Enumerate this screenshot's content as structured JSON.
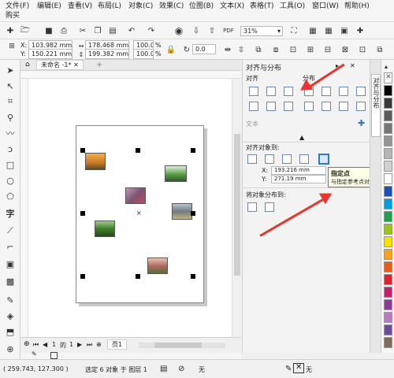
{
  "menu": [
    "文件(F)",
    "编辑(E)",
    "查看(V)",
    "布局(L)",
    "对象(C)",
    "效果(C)",
    "位图(B)",
    "文本(X)",
    "表格(T)",
    "工具(O)",
    "窗口(W)",
    "帮助(H)",
    "购买"
  ],
  "toolbar": {
    "zoom_value": "31%",
    "icons": [
      "new-icon",
      "open-icon",
      "save-icon",
      "print-icon",
      "cut-icon",
      "copy-icon",
      "paste-icon",
      "undo-icon",
      "redo-icon",
      "search-icon",
      "import-icon",
      "export-icon",
      "pdf-icon"
    ]
  },
  "properties": {
    "x_label": "X:",
    "x_value": "103.982 mm",
    "y_label": "Y:",
    "y_value": "150.221 mm",
    "w_value": "178.468 mm",
    "h_value": "199.382 mm",
    "scale_w": "100.0",
    "scale_h": "100.0",
    "pct": "%",
    "rotation": "0.0"
  },
  "document_tab": "未命名 -1*",
  "docker": {
    "title": "对齐与分布",
    "align_label": "对齐",
    "distribute_label": "分布",
    "text_label": "文本",
    "align_to_label": "对齐对象到:",
    "ax_label": "X:",
    "ax_value": "193.216 mm",
    "ay_label": "Y:",
    "ay_value": "271.19 mm",
    "distribute_to_label": "将对象分布到:",
    "tooltip_title": "指定点",
    "tooltip_desc": "与指定参考点对齐。"
  },
  "side_tab_label": "对齐与分布",
  "page_nav": {
    "current": "1",
    "of": "的",
    "total": "1",
    "page_tab": "页1"
  },
  "status": {
    "coords": "( 259.743, 127.300 )",
    "selection": "选定 6 对象 于 图层 1",
    "fill_none": "无",
    "outline_none": "无"
  },
  "colors": {
    "accent": "#2f78c4",
    "arrow": "#e8332f",
    "palette": [
      "#000000",
      "#3a3a3a",
      "#5a5a5a",
      "#777777",
      "#959595",
      "#b5b5b5",
      "#d0d0d0",
      "#ffffff",
      "#1e4fb5",
      "#00a0e0",
      "#1fa04a",
      "#9ac51d",
      "#f4e10b",
      "#f7a11a",
      "#e85d1a",
      "#e0232a",
      "#c51f6a",
      "#8a3a98",
      "#b87ac3",
      "#6b4aa0",
      "#7f6c5a"
    ]
  }
}
